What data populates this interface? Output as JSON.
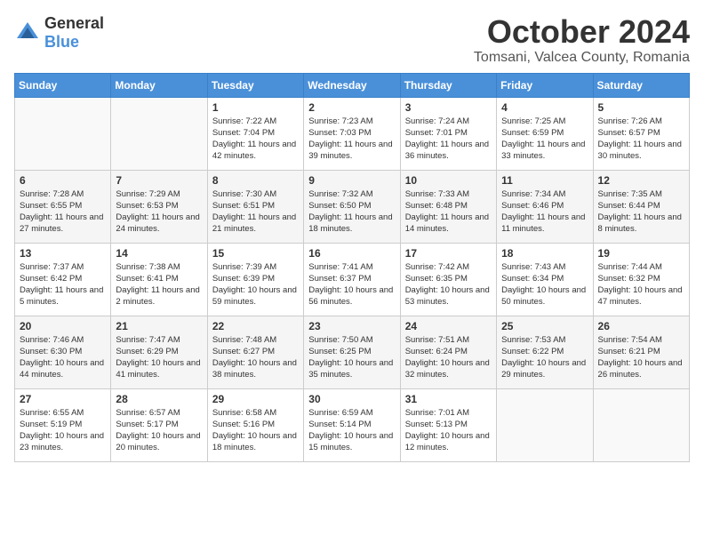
{
  "logo": {
    "text_general": "General",
    "text_blue": "Blue"
  },
  "header": {
    "month": "October 2024",
    "location": "Tomsani, Valcea County, Romania"
  },
  "weekdays": [
    "Sunday",
    "Monday",
    "Tuesday",
    "Wednesday",
    "Thursday",
    "Friday",
    "Saturday"
  ],
  "weeks": [
    [
      {
        "day": "",
        "info": ""
      },
      {
        "day": "",
        "info": ""
      },
      {
        "day": "1",
        "info": "Sunrise: 7:22 AM\nSunset: 7:04 PM\nDaylight: 11 hours and 42 minutes."
      },
      {
        "day": "2",
        "info": "Sunrise: 7:23 AM\nSunset: 7:03 PM\nDaylight: 11 hours and 39 minutes."
      },
      {
        "day": "3",
        "info": "Sunrise: 7:24 AM\nSunset: 7:01 PM\nDaylight: 11 hours and 36 minutes."
      },
      {
        "day": "4",
        "info": "Sunrise: 7:25 AM\nSunset: 6:59 PM\nDaylight: 11 hours and 33 minutes."
      },
      {
        "day": "5",
        "info": "Sunrise: 7:26 AM\nSunset: 6:57 PM\nDaylight: 11 hours and 30 minutes."
      }
    ],
    [
      {
        "day": "6",
        "info": "Sunrise: 7:28 AM\nSunset: 6:55 PM\nDaylight: 11 hours and 27 minutes."
      },
      {
        "day": "7",
        "info": "Sunrise: 7:29 AM\nSunset: 6:53 PM\nDaylight: 11 hours and 24 minutes."
      },
      {
        "day": "8",
        "info": "Sunrise: 7:30 AM\nSunset: 6:51 PM\nDaylight: 11 hours and 21 minutes."
      },
      {
        "day": "9",
        "info": "Sunrise: 7:32 AM\nSunset: 6:50 PM\nDaylight: 11 hours and 18 minutes."
      },
      {
        "day": "10",
        "info": "Sunrise: 7:33 AM\nSunset: 6:48 PM\nDaylight: 11 hours and 14 minutes."
      },
      {
        "day": "11",
        "info": "Sunrise: 7:34 AM\nSunset: 6:46 PM\nDaylight: 11 hours and 11 minutes."
      },
      {
        "day": "12",
        "info": "Sunrise: 7:35 AM\nSunset: 6:44 PM\nDaylight: 11 hours and 8 minutes."
      }
    ],
    [
      {
        "day": "13",
        "info": "Sunrise: 7:37 AM\nSunset: 6:42 PM\nDaylight: 11 hours and 5 minutes."
      },
      {
        "day": "14",
        "info": "Sunrise: 7:38 AM\nSunset: 6:41 PM\nDaylight: 11 hours and 2 minutes."
      },
      {
        "day": "15",
        "info": "Sunrise: 7:39 AM\nSunset: 6:39 PM\nDaylight: 10 hours and 59 minutes."
      },
      {
        "day": "16",
        "info": "Sunrise: 7:41 AM\nSunset: 6:37 PM\nDaylight: 10 hours and 56 minutes."
      },
      {
        "day": "17",
        "info": "Sunrise: 7:42 AM\nSunset: 6:35 PM\nDaylight: 10 hours and 53 minutes."
      },
      {
        "day": "18",
        "info": "Sunrise: 7:43 AM\nSunset: 6:34 PM\nDaylight: 10 hours and 50 minutes."
      },
      {
        "day": "19",
        "info": "Sunrise: 7:44 AM\nSunset: 6:32 PM\nDaylight: 10 hours and 47 minutes."
      }
    ],
    [
      {
        "day": "20",
        "info": "Sunrise: 7:46 AM\nSunset: 6:30 PM\nDaylight: 10 hours and 44 minutes."
      },
      {
        "day": "21",
        "info": "Sunrise: 7:47 AM\nSunset: 6:29 PM\nDaylight: 10 hours and 41 minutes."
      },
      {
        "day": "22",
        "info": "Sunrise: 7:48 AM\nSunset: 6:27 PM\nDaylight: 10 hours and 38 minutes."
      },
      {
        "day": "23",
        "info": "Sunrise: 7:50 AM\nSunset: 6:25 PM\nDaylight: 10 hours and 35 minutes."
      },
      {
        "day": "24",
        "info": "Sunrise: 7:51 AM\nSunset: 6:24 PM\nDaylight: 10 hours and 32 minutes."
      },
      {
        "day": "25",
        "info": "Sunrise: 7:53 AM\nSunset: 6:22 PM\nDaylight: 10 hours and 29 minutes."
      },
      {
        "day": "26",
        "info": "Sunrise: 7:54 AM\nSunset: 6:21 PM\nDaylight: 10 hours and 26 minutes."
      }
    ],
    [
      {
        "day": "27",
        "info": "Sunrise: 6:55 AM\nSunset: 5:19 PM\nDaylight: 10 hours and 23 minutes."
      },
      {
        "day": "28",
        "info": "Sunrise: 6:57 AM\nSunset: 5:17 PM\nDaylight: 10 hours and 20 minutes."
      },
      {
        "day": "29",
        "info": "Sunrise: 6:58 AM\nSunset: 5:16 PM\nDaylight: 10 hours and 18 minutes."
      },
      {
        "day": "30",
        "info": "Sunrise: 6:59 AM\nSunset: 5:14 PM\nDaylight: 10 hours and 15 minutes."
      },
      {
        "day": "31",
        "info": "Sunrise: 7:01 AM\nSunset: 5:13 PM\nDaylight: 10 hours and 12 minutes."
      },
      {
        "day": "",
        "info": ""
      },
      {
        "day": "",
        "info": ""
      }
    ]
  ]
}
